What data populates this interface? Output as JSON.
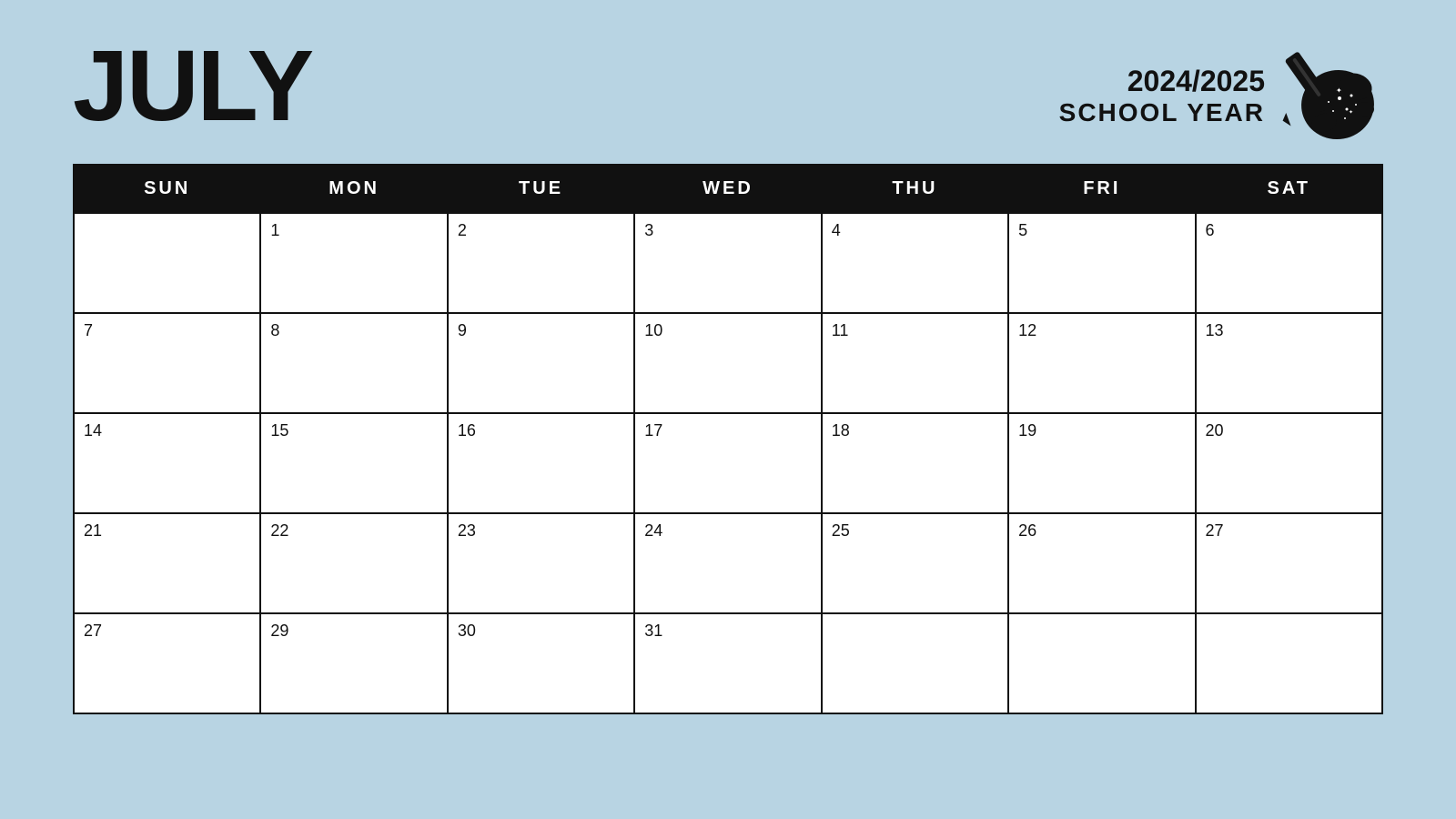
{
  "header": {
    "month": "JULY",
    "year_label": "2024/2025",
    "school_year_label": "SCHOOL YEAR"
  },
  "days_of_week": [
    "SUN",
    "MON",
    "TUE",
    "WED",
    "THU",
    "FRI",
    "SAT"
  ],
  "weeks": [
    [
      "",
      "1",
      "2",
      "3",
      "4",
      "5",
      "6"
    ],
    [
      "7",
      "8",
      "9",
      "10",
      "11",
      "12",
      "13"
    ],
    [
      "14",
      "15",
      "16",
      "17",
      "18",
      "19",
      "20"
    ],
    [
      "21",
      "22",
      "23",
      "24",
      "25",
      "26",
      "27"
    ],
    [
      "27",
      "29",
      "30",
      "31",
      "",
      "",
      ""
    ]
  ],
  "colors": {
    "background": "#b8d4e3",
    "header_bg": "#111111",
    "header_text": "#ffffff",
    "cell_bg": "#ffffff",
    "text": "#111111"
  }
}
